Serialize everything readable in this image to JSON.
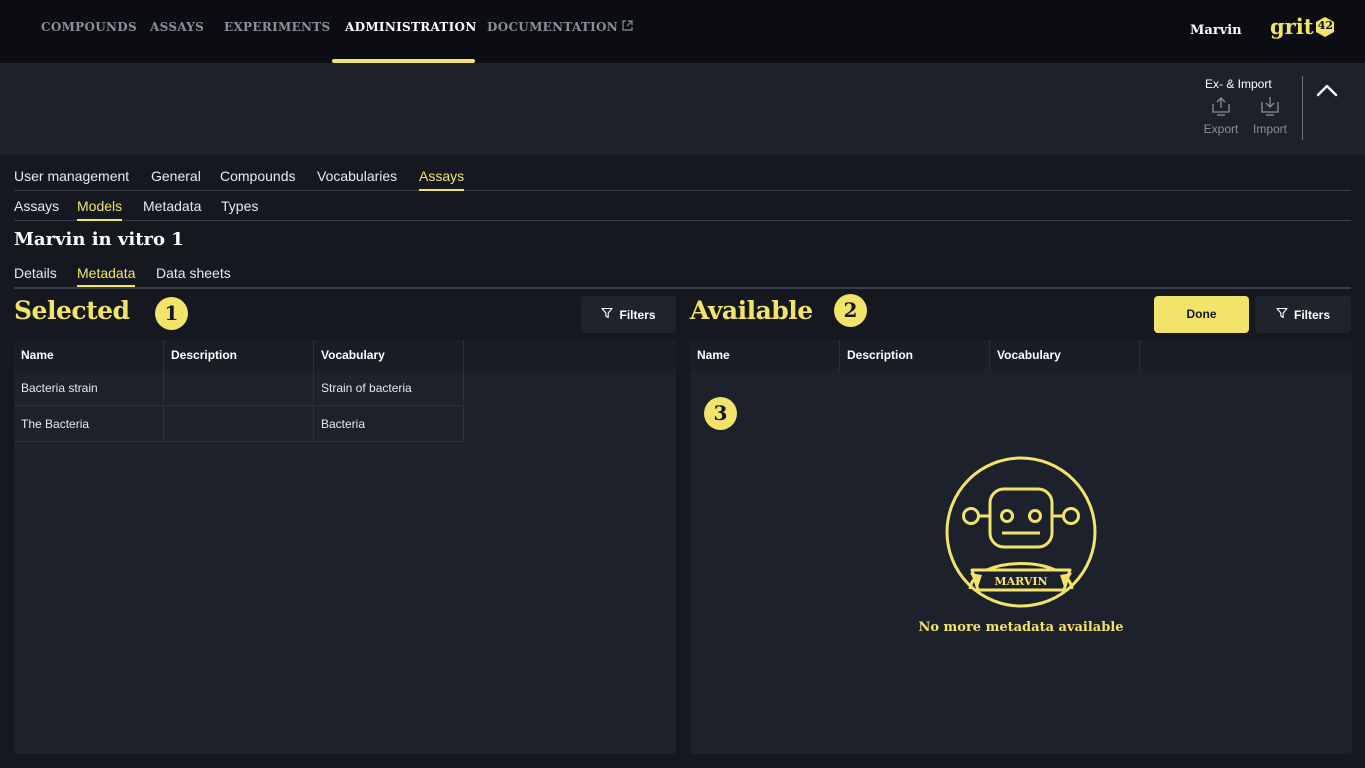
{
  "nav": {
    "items": [
      "COMPOUNDS",
      "ASSAYS",
      "EXPERIMENTS",
      "ADMINISTRATION",
      "DOCUMENTATION"
    ],
    "active": "ADMINISTRATION",
    "user": "Marvin",
    "logo_text": "grit",
    "logo_badge": "42",
    "external_link_icon": "external-link-icon"
  },
  "toolbar": {
    "group_title": "Ex- & Import",
    "export_label": "Export",
    "import_label": "Import",
    "collapse_icon": "chevron-up-icon"
  },
  "admin_tabs": {
    "items": [
      "User management",
      "General",
      "Compounds",
      "Vocabularies",
      "Assays"
    ],
    "active": "Assays"
  },
  "assay_tabs": {
    "items": [
      "Assays",
      "Models",
      "Metadata",
      "Types"
    ],
    "active": "Models"
  },
  "model": {
    "title": "Marvin in vitro 1",
    "tabs": [
      "Details",
      "Metadata",
      "Data sheets"
    ],
    "active_tab": "Metadata"
  },
  "selected": {
    "title": "Selected",
    "badge": "1",
    "filters_label": "Filters",
    "columns": [
      "Name",
      "Description",
      "Vocabulary"
    ],
    "rows": [
      {
        "name": "Bacteria strain",
        "description": "",
        "vocabulary": "Strain of bacteria"
      },
      {
        "name": "The Bacteria",
        "description": "",
        "vocabulary": "Bacteria"
      }
    ]
  },
  "available": {
    "title": "Available",
    "badge": "2",
    "done_label": "Done",
    "filters_label": "Filters",
    "columns": [
      "Name",
      "Description",
      "Vocabulary"
    ],
    "empty_badge": "3",
    "mascot_label": "MARVIN",
    "empty_message": "No more metadata available"
  },
  "colors": {
    "accent": "#f2e36b",
    "background": "#15181f",
    "panel": "#1d212b",
    "nav": "#0c0d12"
  }
}
